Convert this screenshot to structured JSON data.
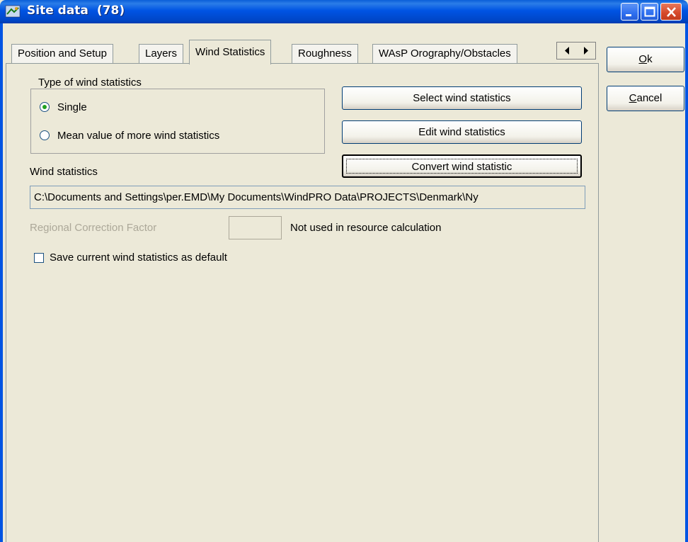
{
  "window": {
    "title": "Site data",
    "count": "(78)",
    "controls": [
      "minimize-icon",
      "maximize-icon",
      "close-icon"
    ]
  },
  "tabs": [
    {
      "label": "Position and Setup",
      "active": false
    },
    {
      "label": "Layers",
      "active": false
    },
    {
      "label": "Wind Statistics",
      "active": true
    },
    {
      "label": "Roughness",
      "active": false
    },
    {
      "label": "WAsP Orography/Obstacles",
      "active": false
    }
  ],
  "tab_scroll": {
    "left_icon": "arrow-left-icon",
    "right_icon": "arrow-right-icon"
  },
  "wind_type": {
    "group_label": "Type of wind statistics",
    "options": [
      {
        "label": "Single",
        "selected": true
      },
      {
        "label": "Mean value of more wind statistics",
        "selected": false
      }
    ]
  },
  "buttons": {
    "select": "Select wind statistics",
    "edit": "Edit wind statistics",
    "convert": "Convert wind statistic"
  },
  "wind_statistics": {
    "label": "Wind statistics",
    "path": "C:\\Documents and Settings\\per.EMD\\My Documents\\WindPRO Data\\PROJECTS\\Denmark\\Ny"
  },
  "regional_correction": {
    "label": "Regional Correction Factor",
    "value": "",
    "note": "Not used in resource calculation"
  },
  "save_default": {
    "label": "Save current wind statistics as default",
    "checked": false
  },
  "side_buttons": {
    "ok_mnemonic": "O",
    "ok_rest": "k",
    "cancel_mnemonic": "C",
    "cancel_rest": "ancel"
  },
  "colors": {
    "titlebar": "#0054e3",
    "dialog_bg": "#ece9d8",
    "disabled_text": "#aca899",
    "radio_dot": "#21a121"
  }
}
